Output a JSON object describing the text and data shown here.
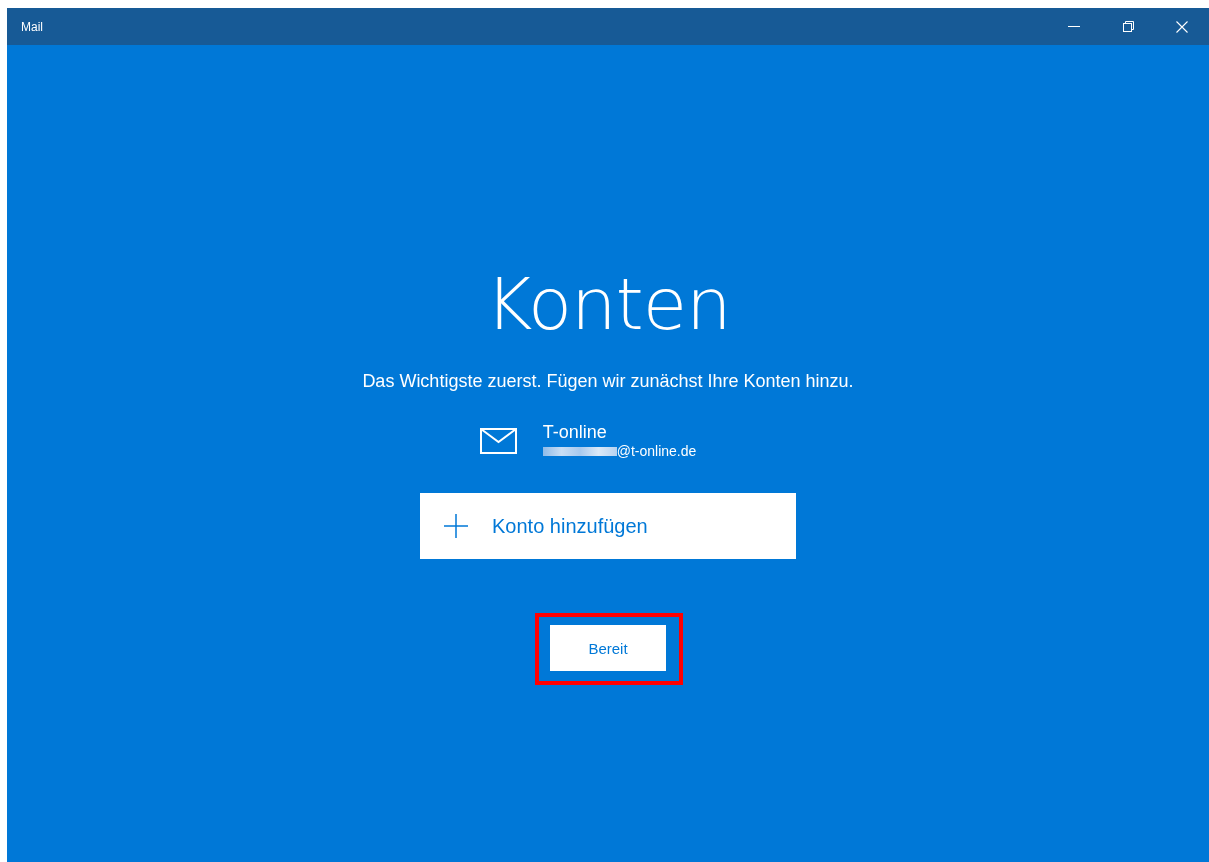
{
  "window": {
    "title": "Mail"
  },
  "heading": "Konten",
  "subtitle": "Das Wichtigste zuerst. Fügen wir zunächst Ihre Konten hinzu.",
  "accounts": [
    {
      "name": "T-online",
      "email": "@t-online.de",
      "email_obscured": true
    }
  ],
  "add_account_button": {
    "label": "Konto hinzufügen"
  },
  "done_button": {
    "label": "Bereit",
    "highlighted": true
  }
}
